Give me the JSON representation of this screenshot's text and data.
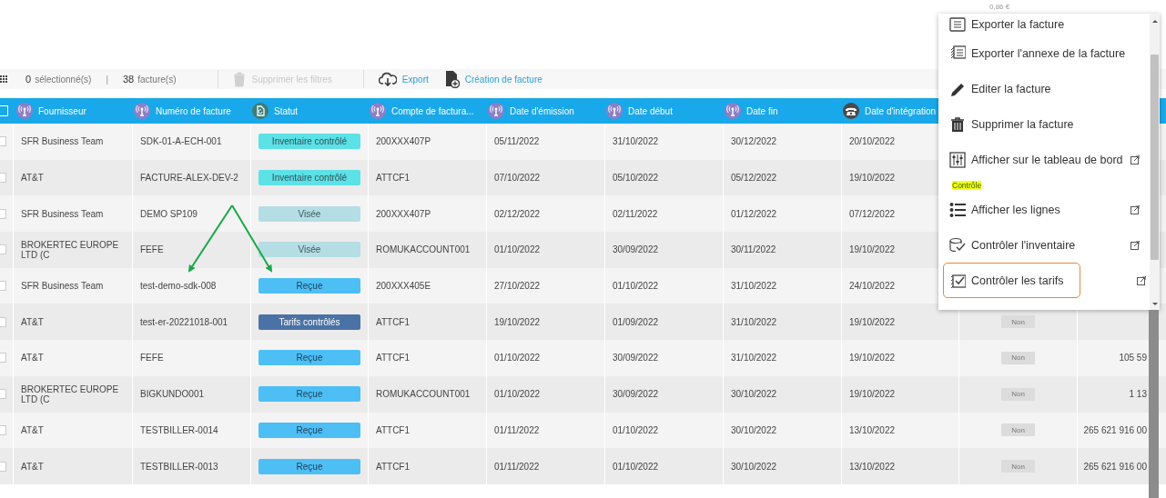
{
  "ghost_value": "0,86 €",
  "toolbar": {
    "selection_count": "0",
    "selection_label": "sélectionné(s)",
    "separator": "|",
    "invoice_count": "38",
    "invoice_label": "facture(s)",
    "actions": [
      {
        "label": "Supprimer les filtres",
        "kind": "clear",
        "disabled": true
      },
      {
        "label": "Export",
        "kind": "export",
        "disabled": false
      },
      {
        "label": "Création de facture",
        "kind": "create",
        "disabled": false
      }
    ]
  },
  "table": {
    "select_all": {
      "checked": false
    },
    "columns": [
      {
        "label": "Fournisseur",
        "kind": "signal"
      },
      {
        "label": "Numéro de facture",
        "kind": "signal"
      },
      {
        "label": "Statut",
        "kind": "status"
      },
      {
        "label": "Compte de factura...",
        "kind": "signal"
      },
      {
        "label": "Date d'émission",
        "kind": "signal"
      },
      {
        "label": "Date début",
        "kind": "signal"
      },
      {
        "label": "Date fin",
        "kind": "signal"
      },
      {
        "label": "Date d'intégration",
        "kind": "phone"
      }
    ],
    "rows": [
      {
        "checked": false,
        "supplier": "SFR Business Team",
        "invoice_number": "SDK-01-A-ECH-001",
        "status": {
          "label": "Inventaire contrôlé",
          "kind": "inventory"
        },
        "billing_account": "200XXX407P",
        "issue_date": "05/11/2022",
        "start_date": "31/10/2022",
        "end_date": "30/12/2022",
        "integration_date": "20/10/2022"
      },
      {
        "checked": false,
        "supplier": "AT&T",
        "invoice_number": "FACTURE-ALEX-DEV-2",
        "status": {
          "label": "Inventaire contrôlé",
          "kind": "inventory"
        },
        "billing_account": "ATTCF1",
        "issue_date": "07/10/2022",
        "start_date": "05/10/2022",
        "end_date": "05/12/2022",
        "integration_date": "19/10/2022"
      },
      {
        "checked": false,
        "supplier": "SFR Business Team",
        "invoice_number": "DEMO SP109",
        "status": {
          "label": "Visée",
          "kind": "viewed"
        },
        "billing_account": "200XXX407P",
        "issue_date": "02/12/2022",
        "start_date": "02/11/2022",
        "end_date": "01/12/2022",
        "integration_date": "07/12/2022"
      },
      {
        "checked": false,
        "supplier": "BROKERTEC EUROPE LTD (C",
        "invoice_number": "FEFE",
        "status": {
          "label": "Visée",
          "kind": "viewed"
        },
        "billing_account": "ROMUKACCOUNT001",
        "issue_date": "01/10/2022",
        "start_date": "30/09/2022",
        "end_date": "30/11/2022",
        "integration_date": "19/10/2022"
      },
      {
        "checked": false,
        "supplier": "SFR Business Team",
        "invoice_number": "test-demo-sdk-008",
        "status": {
          "label": "Reçue",
          "kind": "received"
        },
        "billing_account": "200XXX405E",
        "issue_date": "27/10/2022",
        "start_date": "01/10/2022",
        "end_date": "31/10/2022",
        "integration_date": "24/10/2022"
      },
      {
        "checked": false,
        "supplier": "AT&T",
        "invoice_number": "test-er-20221018-001",
        "status": {
          "label": "Tarifs contrôlés",
          "kind": "rates"
        },
        "billing_account": "ATTCF1",
        "issue_date": "19/10/2022",
        "start_date": "01/09/2022",
        "end_date": "31/10/2022",
        "integration_date": "19/10/2022",
        "column_9": "Non"
      },
      {
        "checked": false,
        "supplier": "AT&T",
        "invoice_number": "FEFE",
        "status": {
          "label": "Reçue",
          "kind": "received"
        },
        "billing_account": "ATTCF1",
        "issue_date": "01/10/2022",
        "start_date": "30/09/2022",
        "end_date": "31/10/2022",
        "integration_date": "19/10/2022",
        "column_9": "Non",
        "column_10": "105 59"
      },
      {
        "checked": false,
        "supplier": "BROKERTEC EUROPE LTD (C",
        "invoice_number": "BIGKUNDO001",
        "status": {
          "label": "Reçue",
          "kind": "received"
        },
        "billing_account": "ROMUKACCOUNT001",
        "issue_date": "01/10/2022",
        "start_date": "30/09/2022",
        "end_date": "30/10/2022",
        "integration_date": "19/10/2022",
        "column_9": "Non",
        "column_10": "1 13"
      },
      {
        "checked": false,
        "supplier": "AT&T",
        "invoice_number": "TESTBILLER-0014",
        "status": {
          "label": "Reçue",
          "kind": "received"
        },
        "billing_account": "ATTCF1",
        "issue_date": "01/11/2022",
        "start_date": "01/10/2022",
        "end_date": "30/10/2022",
        "integration_date": "13/10/2022",
        "column_9": "Non",
        "column_10": "265 621 916 00"
      },
      {
        "checked": false,
        "supplier": "AT&T",
        "invoice_number": "TESTBILLER-0013",
        "status": {
          "label": "Reçue",
          "kind": "received"
        },
        "billing_account": "ATTCF1",
        "issue_date": "01/11/2022",
        "start_date": "01/10/2022",
        "end_date": "30/10/2022",
        "integration_date": "13/10/2022",
        "column_9": "Non",
        "column_10": "265 621 916 00"
      }
    ]
  },
  "context_menu": {
    "items": [
      {
        "kind": "action",
        "label": "Exporter la facture",
        "external": false,
        "highlighted": false
      },
      {
        "kind": "action",
        "label": "Exporter l'annexe de la facture",
        "external": false,
        "highlighted": false
      },
      {
        "kind": "action",
        "label": "Editer la facture",
        "external": false,
        "highlighted": false
      },
      {
        "kind": "action",
        "label": "Supprimer la facture",
        "external": false,
        "highlighted": false
      },
      {
        "kind": "action",
        "label": "Afficher sur le tableau de bord",
        "external": true,
        "highlighted": false
      },
      {
        "kind": "section",
        "label": "Contrôle"
      },
      {
        "kind": "action",
        "label": "Afficher les lignes",
        "external": true,
        "highlighted": false
      },
      {
        "kind": "action",
        "label": "Contrôler l'inventaire",
        "external": true,
        "highlighted": false
      },
      {
        "kind": "action",
        "label": "Contrôler les tarifs",
        "external": true,
        "highlighted": true
      }
    ]
  }
}
